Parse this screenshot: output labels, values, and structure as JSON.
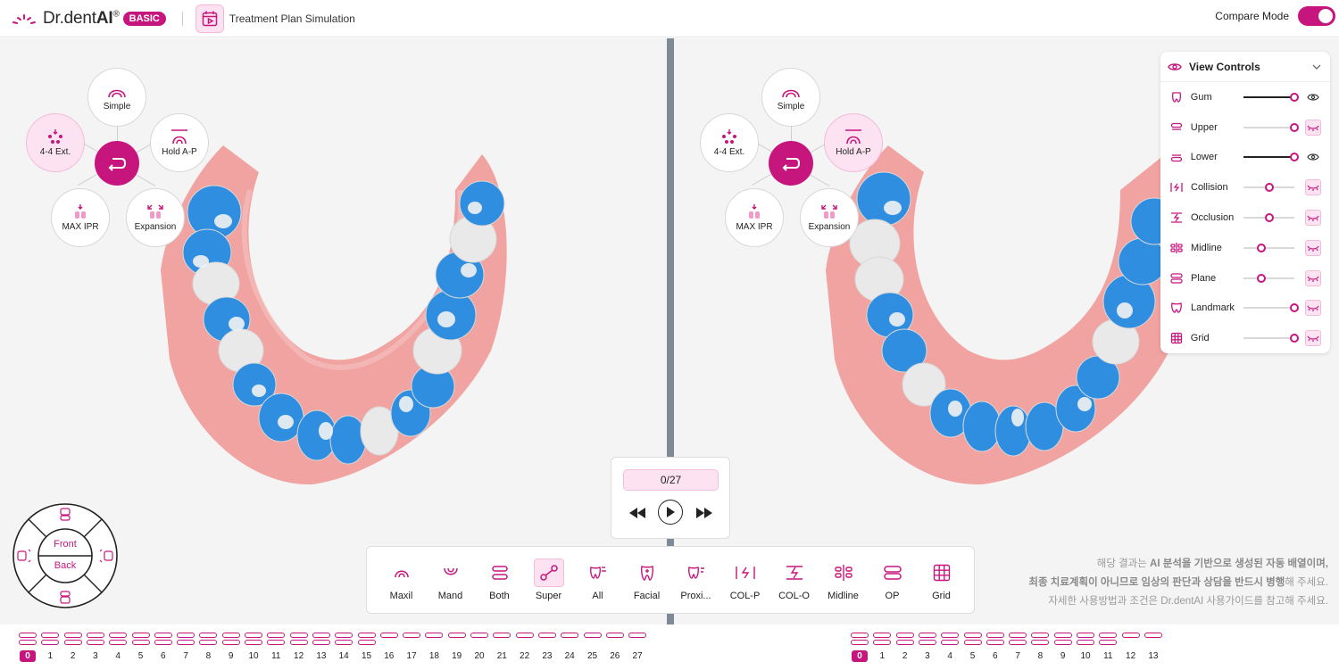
{
  "header": {
    "logo_text_prefix": "Dr.dent",
    "logo_text_ai": "AI",
    "logo_registered": "®",
    "badge": "BASIC",
    "page_title": "Treatment Plan Simulation",
    "compare_label": "Compare Mode",
    "compare_on": true
  },
  "radial_menu": {
    "simple": "Simple",
    "hold_ap": "Hold A-P",
    "ext44": "4-4 Ext.",
    "max_ipr": "MAX IPR",
    "expansion": "Expansion"
  },
  "view_controls": {
    "title": "View Controls",
    "rows": [
      {
        "label": "Gum",
        "level": 1.0,
        "visible": true,
        "icon": "gum-icon"
      },
      {
        "label": "Upper",
        "level": 1.0,
        "visible": false,
        "icon": "upper-jaw-icon"
      },
      {
        "label": "Lower",
        "level": 1.0,
        "visible": true,
        "icon": "lower-jaw-icon"
      },
      {
        "label": "Collision",
        "level": 0.5,
        "visible": false,
        "icon": "collision-icon"
      },
      {
        "label": "Occlusion",
        "level": 0.5,
        "visible": false,
        "icon": "occlusion-icon"
      },
      {
        "label": "Midline",
        "level": 0.35,
        "visible": false,
        "icon": "midline-icon"
      },
      {
        "label": "Plane",
        "level": 0.35,
        "visible": false,
        "icon": "plane-icon"
      },
      {
        "label": "Landmark",
        "level": 1.0,
        "visible": false,
        "icon": "landmark-icon"
      },
      {
        "label": "Grid",
        "level": 1.0,
        "visible": false,
        "icon": "grid-icon"
      }
    ]
  },
  "player": {
    "counter": "0/27"
  },
  "toolbar": [
    {
      "label": "Maxil",
      "icon": "maxilla-icon"
    },
    {
      "label": "Mand",
      "icon": "mandible-icon"
    },
    {
      "label": "Both",
      "icon": "both-arches-icon"
    },
    {
      "label": "Super",
      "icon": "superimpose-icon",
      "active": true
    },
    {
      "label": "All",
      "icon": "all-teeth-icon"
    },
    {
      "label": "Facial",
      "icon": "facial-icon"
    },
    {
      "label": "Proxi...",
      "icon": "proximal-icon"
    },
    {
      "label": "COL-P",
      "icon": "collision-p-icon"
    },
    {
      "label": "COL-O",
      "icon": "collision-o-icon"
    },
    {
      "label": "Midline",
      "icon": "midline-icon"
    },
    {
      "label": "OP",
      "icon": "occlusal-plane-icon"
    },
    {
      "label": "Grid",
      "icon": "grid-icon"
    }
  ],
  "disclaimer": {
    "line1_a": "해당 결과는 ",
    "line1_b": "AI 분석을 기반으로 생성된 자동 배열이며,",
    "line2_a": "최종 치료계획이 아니므로 임상의 판단과 상담을 반드시 병행",
    "line2_b": "해 주세요.",
    "line3": "자세한 사용방법과 조건은 Dr.dentAI 사용가이드를 참고해 주세요."
  },
  "camera_wheel": {
    "front": "Front",
    "back": "Back"
  },
  "timeline_left": {
    "steps": [
      "0",
      "1",
      "2",
      "3",
      "4",
      "5",
      "6",
      "7",
      "8",
      "9",
      "10",
      "11",
      "12",
      "13",
      "14",
      "15",
      "16",
      "17",
      "18",
      "19",
      "20",
      "21",
      "22",
      "23",
      "24",
      "25",
      "26",
      "27"
    ],
    "current": "0"
  },
  "timeline_right": {
    "steps": [
      "0",
      "1",
      "2",
      "3",
      "4",
      "5",
      "6",
      "7",
      "8",
      "9",
      "10",
      "11",
      "12",
      "13"
    ],
    "current": "0"
  },
  "colors": {
    "accent": "#c6167d",
    "accent_light": "#fde3f1",
    "gum": "#f0a3a0",
    "tooth_blue": "#2f8ee0",
    "tooth_white": "#f2f2f2"
  }
}
